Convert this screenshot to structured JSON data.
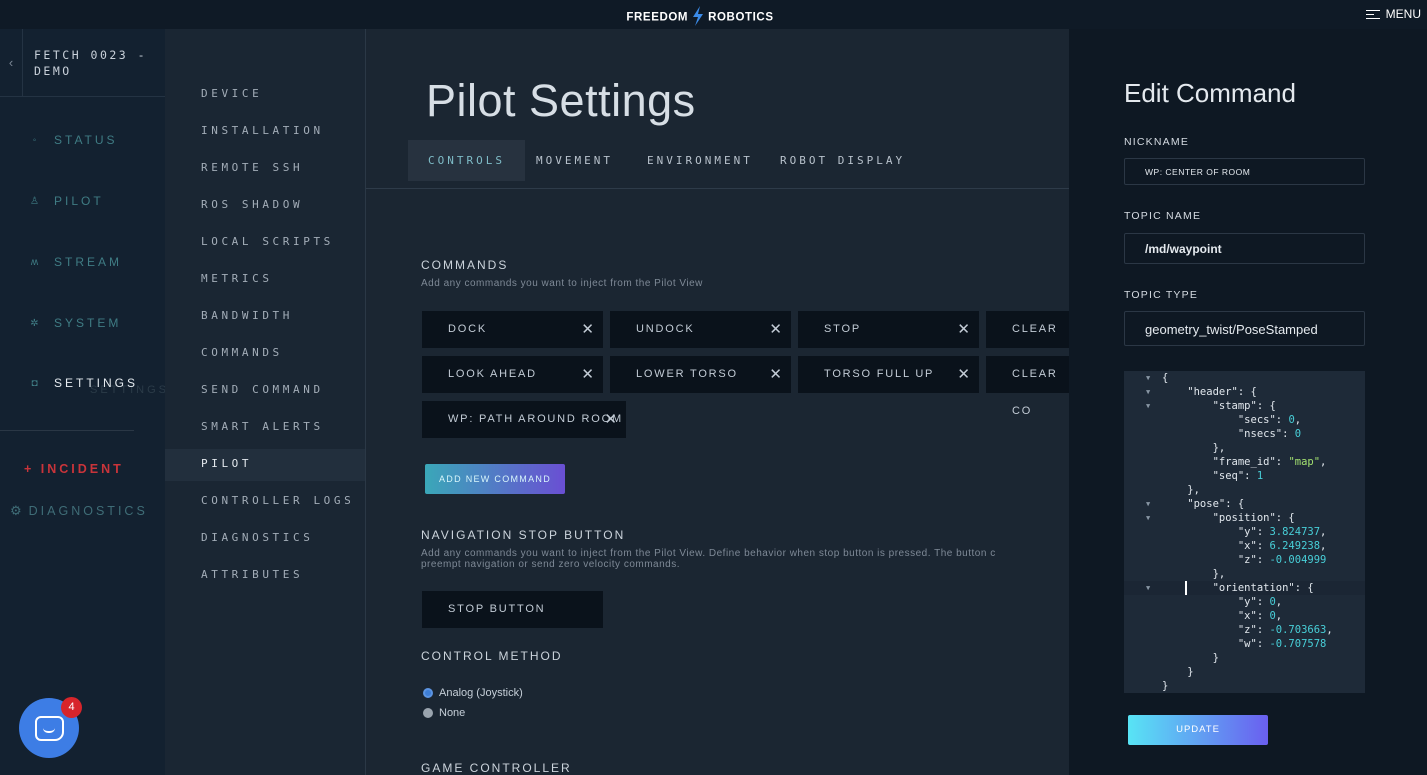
{
  "header": {
    "logo_left": "FREEDOM",
    "logo_right": "ROBOTICS",
    "menu_label": "MENU"
  },
  "device": {
    "back_label": "‹",
    "name": "FETCH 0023 - DEMO"
  },
  "nav": {
    "items": [
      {
        "label": "STATUS",
        "icon": "status-icon"
      },
      {
        "label": "PILOT",
        "icon": "pilot-icon"
      },
      {
        "label": "STREAM",
        "icon": "stream-icon"
      },
      {
        "label": "SYSTEM",
        "icon": "system-gear-icon"
      },
      {
        "label": "SETTINGS",
        "icon": "settings-icon",
        "active": true
      }
    ],
    "ghost_label": "SETTINGS",
    "incident_label": "+ INCIDENT",
    "diagnostics_label": "DIAGNOSTICS"
  },
  "chat": {
    "badge_count": "4"
  },
  "settings_menu": {
    "items": [
      "DEVICE",
      "INSTALLATION",
      "REMOTE SSH",
      "ROS SHADOW",
      "LOCAL SCRIPTS",
      "METRICS",
      "BANDWIDTH",
      "COMMANDS",
      "SEND COMMAND",
      "SMART ALERTS",
      "PILOT",
      "CONTROLLER LOGS",
      "DIAGNOSTICS",
      "ATTRIBUTES"
    ],
    "active": "PILOT"
  },
  "page": {
    "title": "Pilot Settings",
    "tabs": [
      "CONTROLS",
      "MOVEMENT",
      "ENVIRONMENT",
      "ROBOT DISPLAY"
    ],
    "active_tab": "CONTROLS"
  },
  "commands": {
    "heading": "COMMANDS",
    "description": "Add any commands you want to inject from the Pilot View",
    "chips": [
      "DOCK",
      "UNDOCK",
      "STOP",
      "CLEAR FA",
      "LOOK AHEAD",
      "LOWER TORSO",
      "TORSO FULL UP",
      "CLEAR CO",
      "WP: PATH AROUND ROOM"
    ],
    "close_glyph": "✕",
    "add_button": "ADD NEW COMMAND"
  },
  "nav_stop": {
    "heading": "NAVIGATION STOP BUTTON",
    "description_line1": "Add any commands you want to inject from the Pilot View. Define behavior when stop button is pressed. The button c",
    "description_line2": "preempt navigation or send zero velocity commands.",
    "button": "STOP BUTTON"
  },
  "control_method": {
    "heading": "CONTROL METHOD",
    "options": [
      "Analog (Joystick)",
      "None"
    ],
    "selected": "Analog (Joystick)"
  },
  "game_controller": {
    "heading": "GAME CONTROLLER"
  },
  "edit_command": {
    "title": "Edit Command",
    "nickname_label": "NICKNAME",
    "nickname_value": "WP: CENTER OF ROOM",
    "topic_name_label": "TOPIC NAME",
    "topic_name_value": "/md/waypoint",
    "topic_type_label": "TOPIC TYPE",
    "topic_type_value": "geometry_twist/PoseStamped",
    "update_button": "UPDATE",
    "json_lines": [
      "{",
      "    \"header\": {",
      "        \"stamp\": {",
      "            \"secs\": 0,",
      "            \"nsecs\": 0",
      "        },",
      "        \"frame_id\": \"map\",",
      "        \"seq\": 1",
      "    },",
      "    \"pose\": {",
      "        \"position\": {",
      "            \"y\": 3.824737,",
      "            \"x\": 6.249238,",
      "            \"z\": -0.004999",
      "        },",
      "        \"orientation\": {",
      "            \"y\": 0,",
      "            \"x\": 0,",
      "            \"z\": -0.703663,",
      "            \"w\": -0.707578",
      "        }",
      "    }",
      "}"
    ]
  },
  "colors": {
    "accent": "#7fbcc7",
    "incident": "#c9343a",
    "chat": "#3d7de5",
    "json_number": "#48cfd8",
    "json_string": "#a3e070"
  }
}
